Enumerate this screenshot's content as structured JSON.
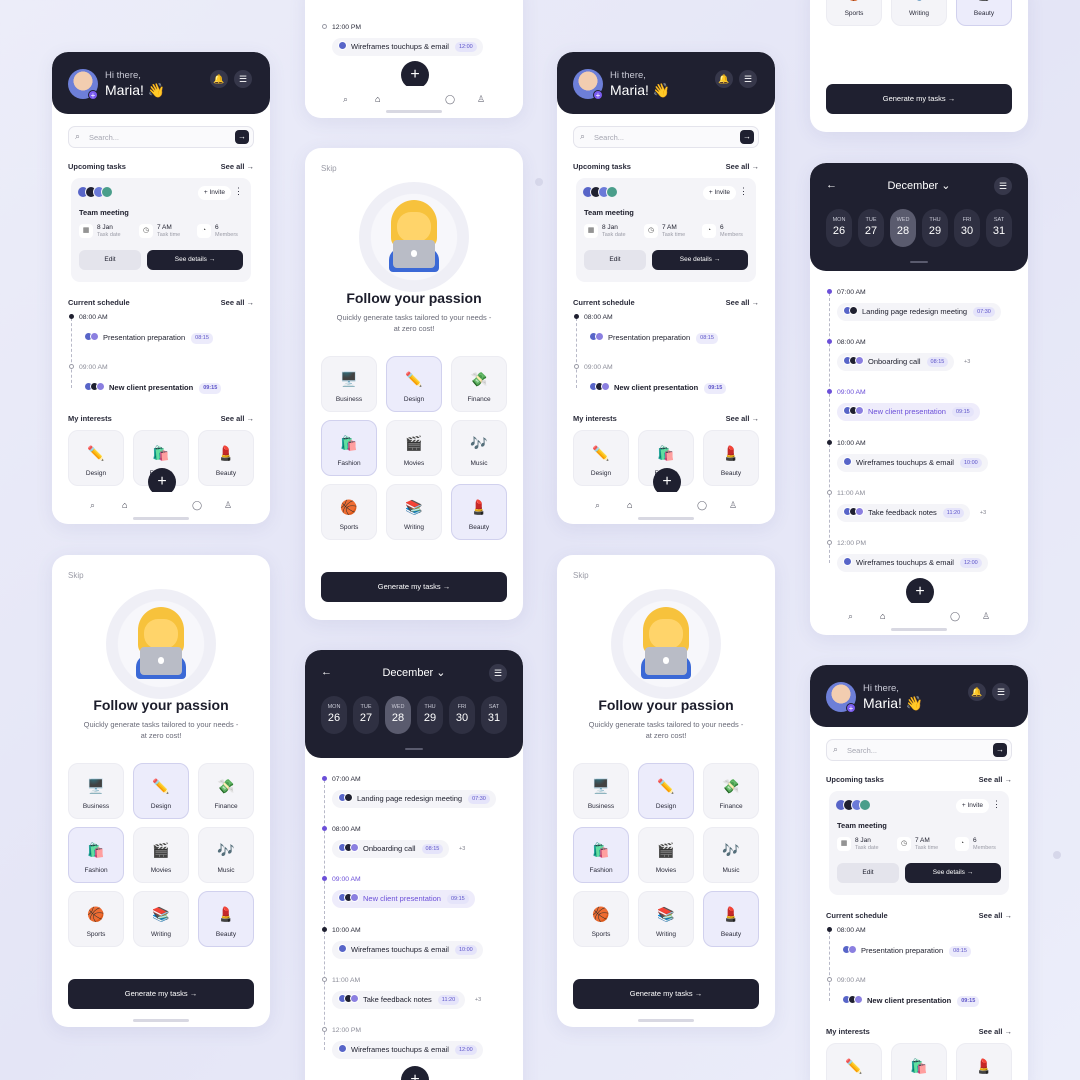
{
  "home": {
    "greeting": "Hi there,",
    "name": "Maria! 👋",
    "search_placeholder": "Search...",
    "upcoming_title": "Upcoming tasks",
    "see_all": "See all →",
    "invite": "+ Invite",
    "task_name": "Team meeting",
    "meta": [
      {
        "icon": "calendar-icon",
        "value": "8 Jan",
        "label": "Task date"
      },
      {
        "icon": "clock-icon",
        "value": "7 AM",
        "label": "Task time"
      },
      {
        "icon": "members-icon",
        "value": "6",
        "label": "Members"
      }
    ],
    "edit": "Edit",
    "details": "See details →",
    "schedule_title": "Current schedule",
    "schedule": [
      {
        "time": "08:00 AM",
        "event": "Presentation preparation",
        "duration": "08:15"
      },
      {
        "time": "09:00 AM",
        "event": "New client presentation",
        "duration": "09:15"
      }
    ],
    "interests_title": "My interests",
    "interests": [
      {
        "emoji": "✏️",
        "label": "Design"
      },
      {
        "emoji": "🛍️",
        "label": "Fashion"
      },
      {
        "emoji": "💄",
        "label": "Beauty"
      }
    ]
  },
  "onboarding": {
    "skip": "Skip",
    "title": "Follow your passion",
    "subtitle": "Quickly generate tasks tailored to your needs - at zero cost!",
    "interests": [
      {
        "emoji": "🖥️",
        "label": "Business",
        "selected": false
      },
      {
        "emoji": "✏️",
        "label": "Design",
        "selected": true
      },
      {
        "emoji": "💸",
        "label": "Finance",
        "selected": false
      },
      {
        "emoji": "🛍️",
        "label": "Fashion",
        "selected": true
      },
      {
        "emoji": "🎬",
        "label": "Movies",
        "selected": false
      },
      {
        "emoji": "🎶",
        "label": "Music",
        "selected": false
      },
      {
        "emoji": "🏀",
        "label": "Sports",
        "selected": false
      },
      {
        "emoji": "📚",
        "label": "Writing",
        "selected": false
      },
      {
        "emoji": "💄",
        "label": "Beauty",
        "selected": true
      }
    ],
    "cta": "Generate my tasks →"
  },
  "calendar": {
    "month": "December ⌄",
    "days": [
      {
        "name": "MON",
        "num": "26"
      },
      {
        "name": "TUE",
        "num": "27"
      },
      {
        "name": "WED",
        "num": "28"
      },
      {
        "name": "THU",
        "num": "29"
      },
      {
        "name": "FRI",
        "num": "30"
      },
      {
        "name": "SAT",
        "num": "31"
      }
    ],
    "events": [
      {
        "time": "07:00 AM",
        "event": "Landing page redesign meeting",
        "duration": "07:30",
        "extra": ""
      },
      {
        "time": "08:00 AM",
        "event": "Onboarding call",
        "duration": "08:15",
        "extra": "+3"
      },
      {
        "time": "09:00 AM",
        "event": "New client presentation",
        "duration": "09:15",
        "extra": ""
      },
      {
        "time": "10:00 AM",
        "event": "Wireframes touchups & email",
        "duration": "10:00",
        "extra": ""
      },
      {
        "time": "11:00 AM",
        "event": "Take feedback notes",
        "duration": "11:20",
        "extra": "+3"
      },
      {
        "time": "12:00 PM",
        "event": "Wireframes touchups & email",
        "duration": "12:00",
        "extra": ""
      }
    ]
  },
  "icons": {
    "bell": "bell-icon",
    "menu": "menu-icon",
    "search": "search-icon",
    "home": "home-icon",
    "chat": "chat-icon",
    "profile": "profile-icon",
    "add": "add-icon",
    "back": "back-arrow-icon"
  },
  "colors": {
    "dark": "#1f2030",
    "accent": "#6b4fd8",
    "background": "#e8e9f7"
  }
}
